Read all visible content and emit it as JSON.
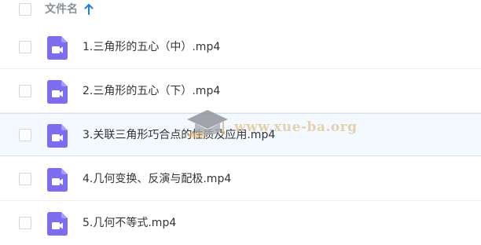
{
  "header": {
    "column_label": "文件名",
    "sort_icon": "arrow-up-icon",
    "sort_color": "#1a7ef2"
  },
  "files": [
    {
      "name": "1.三角形的五心（中）.mp4",
      "icon": "video-file-icon"
    },
    {
      "name": "2.三角形的五心（下）.mp4",
      "icon": "video-file-icon"
    },
    {
      "name": "3.关联三角形巧合点的性质及应用.mp4",
      "icon": "video-file-icon"
    },
    {
      "name": "4.几何变换、反演与配极.mp4",
      "icon": "video-file-icon"
    },
    {
      "name": "5.几何不等式.mp4",
      "icon": "video-file-icon"
    }
  ],
  "watermark": {
    "text": "www.xue-ba.org",
    "icon": "graduation-cap-icon"
  },
  "colors": {
    "file_icon": "#7b6cf0",
    "row_hover": "#f4f9ff",
    "watermark": "#e3c9a0"
  }
}
